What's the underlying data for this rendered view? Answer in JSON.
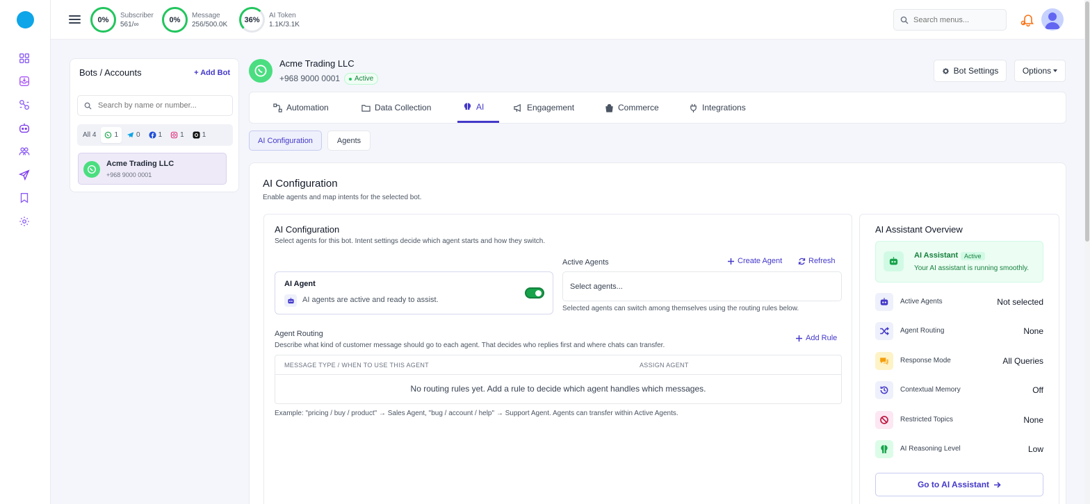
{
  "colors": {
    "accent": "#4338ca",
    "success": "#22c55e",
    "whatsapp": "#4ade80"
  },
  "topbar": {
    "stats": [
      {
        "percent": "0%",
        "label": "Subscriber",
        "value": "561/∞"
      },
      {
        "percent": "0%",
        "label": "Message",
        "value": "256/500.0K"
      },
      {
        "percent": "36%",
        "label": "AI Token",
        "value": "1.1K/3.1K"
      }
    ],
    "search_placeholder": "Search menus..."
  },
  "sidebar": {
    "icons": [
      "dashboard-icon",
      "inbox-icon",
      "flow-icon",
      "bot-icon",
      "users-icon",
      "send-icon",
      "bookmark-icon",
      "settings-icon"
    ]
  },
  "bots": {
    "title": "Bots / Accounts",
    "add_label": "Add Bot",
    "search_placeholder": "Search by name or number...",
    "filters": [
      {
        "label": "All",
        "count": "4",
        "icon": ""
      },
      {
        "label": "",
        "count": "1",
        "icon": "whatsapp-icon"
      },
      {
        "label": "",
        "count": "0",
        "icon": "telegram-icon"
      },
      {
        "label": "",
        "count": "1",
        "icon": "facebook-icon"
      },
      {
        "label": "",
        "count": "1",
        "icon": "instagram-icon"
      },
      {
        "label": "",
        "count": "1",
        "icon": "threads-icon"
      }
    ],
    "items": [
      {
        "name": "Acme Trading LLC",
        "phone": "+968 9000 0001"
      }
    ]
  },
  "header": {
    "name": "Acme Trading LLC",
    "phone": "+968 9000 0001",
    "status": "Active",
    "bot_settings_label": "Bot Settings",
    "options_label": "Options"
  },
  "tabs": [
    {
      "label": "Automation",
      "icon": "automation-icon"
    },
    {
      "label": "Data Collection",
      "icon": "folder-icon"
    },
    {
      "label": "AI",
      "icon": "brain-icon"
    },
    {
      "label": "Engagement",
      "icon": "megaphone-icon"
    },
    {
      "label": "Commerce",
      "icon": "bag-icon"
    },
    {
      "label": "Integrations",
      "icon": "plug-icon"
    }
  ],
  "active_tab": "AI",
  "subtabs": [
    {
      "label": "AI Configuration"
    },
    {
      "label": "Agents"
    }
  ],
  "main": {
    "title": "AI Configuration",
    "subtitle": "Enable agents and map intents for the selected bot.",
    "config": {
      "title": "AI Configuration",
      "subtitle": "Select agents for this bot. Intent settings decide which agent starts and how they switch.",
      "agent_card": {
        "title": "AI Agent",
        "desc": "AI agents are active and ready to assist.",
        "enabled": true
      },
      "active_agents_label": "Active Agents",
      "create_agent_label": "Create Agent",
      "refresh_label": "Refresh",
      "select_placeholder": "Select agents...",
      "select_hint": "Selected agents can switch among themselves using the routing rules below.",
      "routing_label": "Agent Routing",
      "routing_desc": "Describe what kind of customer message should go to each agent. That decides who replies first and where chats can transfer.",
      "add_rule_label": "Add Rule",
      "table_headers": [
        "MESSAGE TYPE / WHEN TO USE THIS AGENT",
        "ASSIGN AGENT"
      ],
      "table_empty": "No routing rules yet. Add a rule to decide which agent handles which messages.",
      "example": "Example: \"pricing / buy / product\" → Sales Agent, \"bug / account / help\" → Support Agent. Agents can transfer within Active Agents."
    },
    "overview": {
      "title": "AI Assistant Overview",
      "status_title": "AI Assistant",
      "status_badge": "Active",
      "status_desc": "Your AI assistant is running smoothly.",
      "rows": [
        {
          "key": "Active Agents",
          "value": "Not selected",
          "icon": "robot-icon",
          "color": "#eef0fb"
        },
        {
          "key": "Agent Routing",
          "value": "None",
          "icon": "shuffle-icon",
          "color": "#eef0fb"
        },
        {
          "key": "Response Mode",
          "value": "All Queries",
          "icon": "chat-icon",
          "color": "#fef3c7"
        },
        {
          "key": "Contextual Memory",
          "value": "Off",
          "icon": "history-icon",
          "color": "#eef0fb"
        },
        {
          "key": "Restricted Topics",
          "value": "None",
          "icon": "ban-icon",
          "color": "#fce7f3"
        },
        {
          "key": "AI Reasoning Level",
          "value": "Low",
          "icon": "brain-icon",
          "color": "#dcfce7"
        }
      ],
      "goto_label": "Go to AI Assistant"
    }
  }
}
